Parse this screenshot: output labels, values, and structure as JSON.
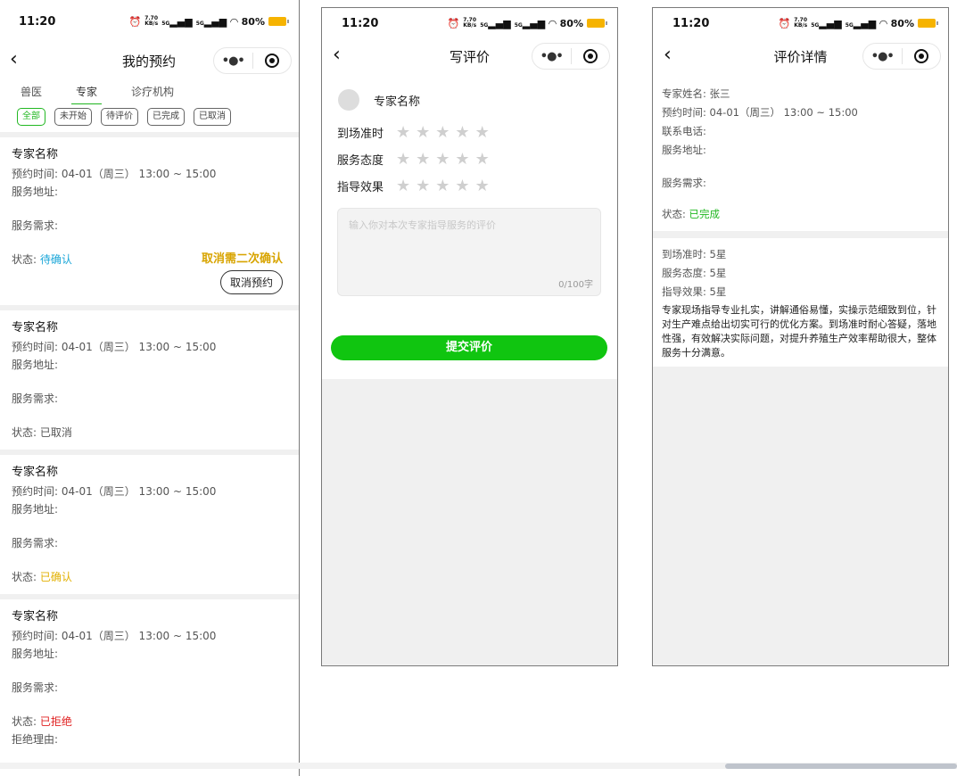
{
  "status_bar": {
    "time": "11:20",
    "speed": "7.70",
    "speed_unit": "KB/s",
    "net1": "5G",
    "net2": "5G",
    "battery": "80%"
  },
  "page1": {
    "title": "我的预约",
    "tabs": [
      "兽医",
      "专家",
      "诊疗机构"
    ],
    "active_tab": 1,
    "filters": [
      "全部",
      "未开始",
      "待评价",
      "已完成",
      "已取消"
    ],
    "cards": [
      {
        "name": "专家名称",
        "time_label": "预约时间:",
        "time": "04-01（周三）  13:00 ~ 15:00",
        "addr_label": "服务地址:",
        "req_label": "服务需求:",
        "status_label": "状态:",
        "status": "待确认",
        "status_class": "st-blue"
      },
      {
        "name": "专家名称",
        "time_label": "预约时间:",
        "time": "04-01（周三）  13:00 ~ 15:00",
        "addr_label": "服务地址:",
        "req_label": "服务需求:",
        "status_label": "状态:",
        "status": "已取消",
        "status_class": ""
      },
      {
        "name": "专家名称",
        "time_label": "预约时间:",
        "time": "04-01（周三）  13:00 ~ 15:00",
        "addr_label": "服务地址:",
        "req_label": "服务需求:",
        "status_label": "状态:",
        "status": "已确认",
        "status_class": "st-yellow"
      },
      {
        "name": "专家名称",
        "time_label": "预约时间:",
        "time": "04-01（周三）  13:00 ~ 15:00",
        "addr_label": "服务地址:",
        "req_label": "服务需求:",
        "status_label": "状态:",
        "status": "已拒绝",
        "status_class": "st-red",
        "reject_label": "拒绝理由:"
      }
    ],
    "cancel_note": "取消需二次确认",
    "cancel_button": "取消预约"
  },
  "page2": {
    "title": "写评价",
    "expert_name": "专家名称",
    "ratings": [
      "到场准时",
      "服务态度",
      "指导效果"
    ],
    "placeholder": "输入你对本次专家指导服务的评价",
    "counter": "0/100字",
    "submit": "提交评价"
  },
  "page3": {
    "title": "评价详情",
    "expert": "专家姓名: 张三",
    "time": "预约时间: 04-01（周三） 13:00 ~ 15:00",
    "phone": "联系电话:",
    "addr": "服务地址:",
    "req": "服务需求:",
    "status_label": "状态:",
    "status": "已完成",
    "punctual": "到场准时: 5星",
    "attitude": "服务态度: 5星",
    "effect": "指导效果: 5星",
    "review": "专家现场指导专业扎实，讲解通俗易懂，实操示范细致到位，针对生产难点给出切实可行的优化方案。到场准时耐心答疑，落地性强，有效解决实际问题，对提升养殖生产效率帮助很大，整体服务十分满意。"
  },
  "colors": {
    "accent_green": "#10c510",
    "pending_blue": "#1aa6d8",
    "confirmed_yellow": "#e2b000",
    "rejected_red": "#e02020"
  }
}
